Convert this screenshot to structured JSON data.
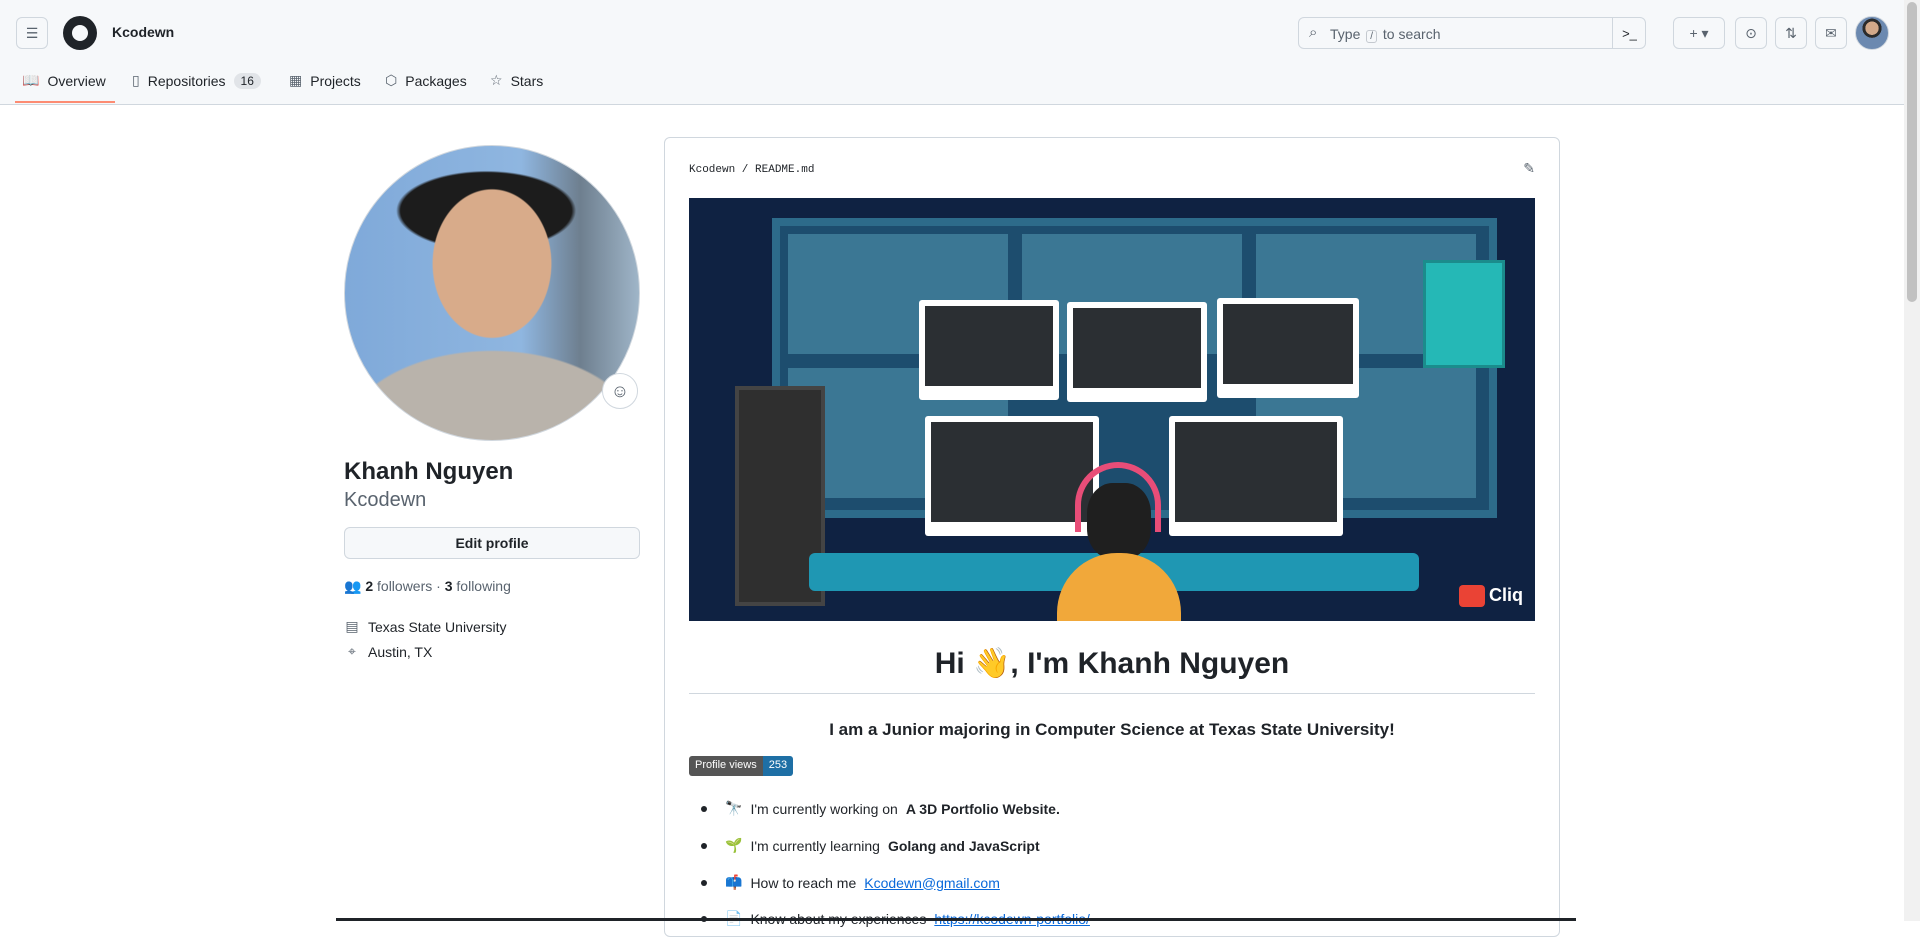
{
  "header": {
    "brand": "Kcodewn",
    "search_placeholder_pre": "Type",
    "search_slash": "/",
    "search_placeholder_post": "to search",
    "plus_label": "+ ▾"
  },
  "tabs": [
    {
      "label": "Overview",
      "icon": "book-icon"
    },
    {
      "label": "Repositories",
      "icon": "repo-icon",
      "count": "16"
    },
    {
      "label": "Projects",
      "icon": "table-icon"
    },
    {
      "label": "Packages",
      "icon": "package-icon"
    },
    {
      "label": "Stars",
      "icon": "star-icon"
    }
  ],
  "profile": {
    "name": "Khanh Nguyen",
    "username": "Kcodewn",
    "edit_label": "Edit profile",
    "followers_count": "2",
    "followers_label": "followers",
    "dot": "·",
    "following_count": "3",
    "following_label": "following",
    "organization": "Texas State University",
    "location": "Austin, TX"
  },
  "readme": {
    "path": "Kcodewn / README.md",
    "banner_brand": "Cliq",
    "greeting": "Hi 👋, I'm Khanh Nguyen",
    "tagline": "I am a Junior majoring in Computer Science at Texas State University!",
    "badge_left": "Profile views",
    "badge_right": "253",
    "items": [
      {
        "emoji": "🔭",
        "text": "I'm currently working on",
        "strong": "A 3D Portfolio Website."
      },
      {
        "emoji": "🌱",
        "text": "I'm currently learning",
        "strong": "Golang and JavaScript"
      },
      {
        "emoji": "📫",
        "text": "How to reach me",
        "link": "Kcodewn@gmail.com"
      },
      {
        "emoji": "📄",
        "text": "Know about my experiences",
        "link": "https://kcodewn-portfolio/"
      }
    ]
  },
  "colors": {
    "accent_underline": "#fd8c73",
    "link": "#0969da",
    "badge_value_bg": "#1e6fa5"
  }
}
